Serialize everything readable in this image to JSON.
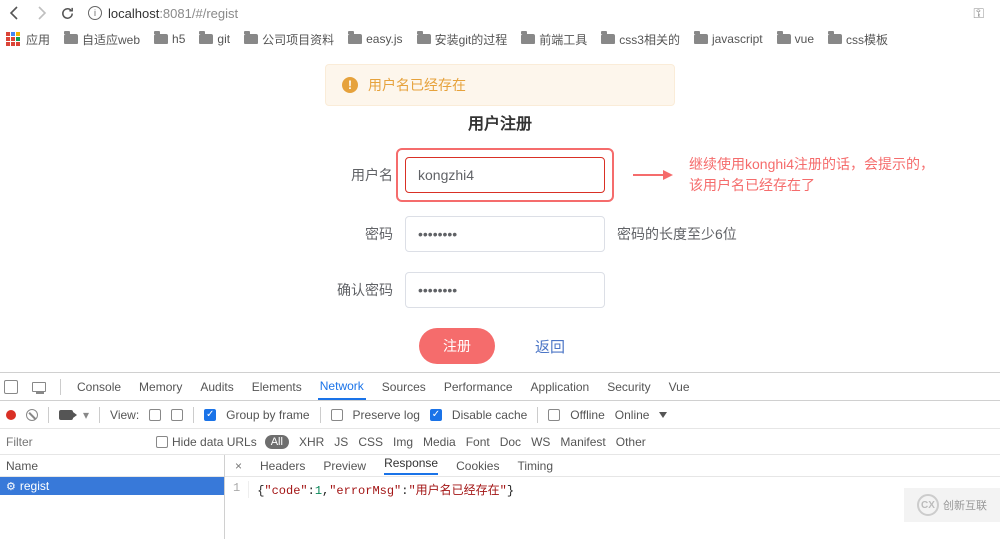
{
  "toolbar": {
    "host": "localhost",
    "port": ":8081",
    "path": "/#/regist"
  },
  "bookmarks": {
    "apps": "应用",
    "items": [
      "自适应web",
      "h5",
      "git",
      "公司项目资料",
      "easy.js",
      "安装git的过程",
      "前端工具",
      "css3相关的",
      "javascript",
      "vue",
      "css模板"
    ]
  },
  "page": {
    "alert": "用户名已经存在",
    "title": "用户注册",
    "labels": {
      "username": "用户名",
      "password": "密码",
      "confirm": "确认密码"
    },
    "values": {
      "username": "kongzhi4",
      "password": "••••••••",
      "confirm": "••••••••"
    },
    "password_hint": "密码的长度至少6位",
    "annotation": "继续使用konghi4注册的话，会提示的，该用户名已经存在了",
    "buttons": {
      "submit": "注册",
      "return": "返回"
    }
  },
  "devtools": {
    "tabs": [
      "Console",
      "Memory",
      "Audits",
      "Elements",
      "Network",
      "Sources",
      "Performance",
      "Application",
      "Security",
      "Vue"
    ],
    "active_tab": "Network",
    "filterbar": {
      "view": "View:",
      "group": "Group by frame",
      "preserve": "Preserve log",
      "disable_cache": "Disable cache",
      "offline": "Offline",
      "online": "Online"
    },
    "filterrow": {
      "placeholder": "Filter",
      "hide": "Hide data URLs",
      "all": "All",
      "opts": [
        "XHR",
        "JS",
        "CSS",
        "Img",
        "Media",
        "Font",
        "Doc",
        "WS",
        "Manifest",
        "Other"
      ]
    },
    "net": {
      "name_hdr": "Name",
      "row": "regist"
    },
    "detail": {
      "tabs": [
        "Headers",
        "Preview",
        "Response",
        "Cookies",
        "Timing"
      ],
      "active": "Response",
      "line": "1",
      "json_code": "{\"code\":1,\"errorMsg\":\"用户名已经存在\"}",
      "json": {
        "code": 1,
        "errorMsg": "用户名已经存在"
      }
    }
  },
  "watermark": "创新互联"
}
